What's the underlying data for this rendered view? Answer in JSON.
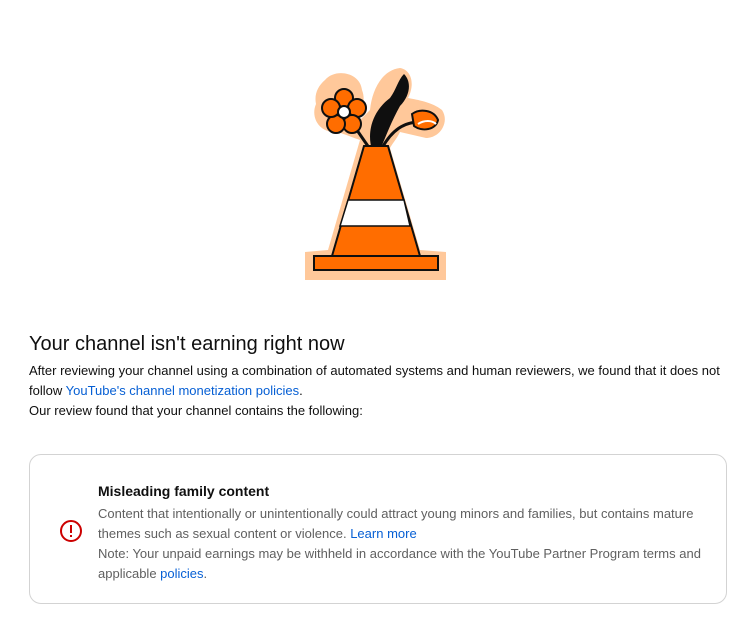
{
  "page": {
    "heading": "Your channel isn't earning right now",
    "description_text": "After reviewing your channel using a combination of automated systems and human reviewers, we found that it does not follow ",
    "description_link": "YouTube's channel monetization policies",
    "description_end": ".",
    "review_line": "Our review found that your channel contains the following:"
  },
  "illustration": {
    "icon": "traffic-cone-with-flowers",
    "colors": {
      "orange": "#ff6d00",
      "peach": "#ffc89a",
      "black": "#0f0f0f",
      "white": "#ffffff"
    }
  },
  "violation_card": {
    "icon": "exclamation-circle-icon",
    "icon_color": "#cc0000",
    "title": "Misleading family content",
    "body_text": "Content that intentionally or unintentionally could attract young minors and families, but contains mature themes such as sexual content or violence. ",
    "learn_more": "Learn more",
    "note_text": "Note: Your unpaid earnings may be withheld in accordance with the YouTube Partner Program terms and applicable ",
    "policies_link": "policies",
    "note_end": "."
  },
  "colors": {
    "link": "#065fd4",
    "secondary_text": "#606060",
    "border": "#d3d3d3"
  }
}
